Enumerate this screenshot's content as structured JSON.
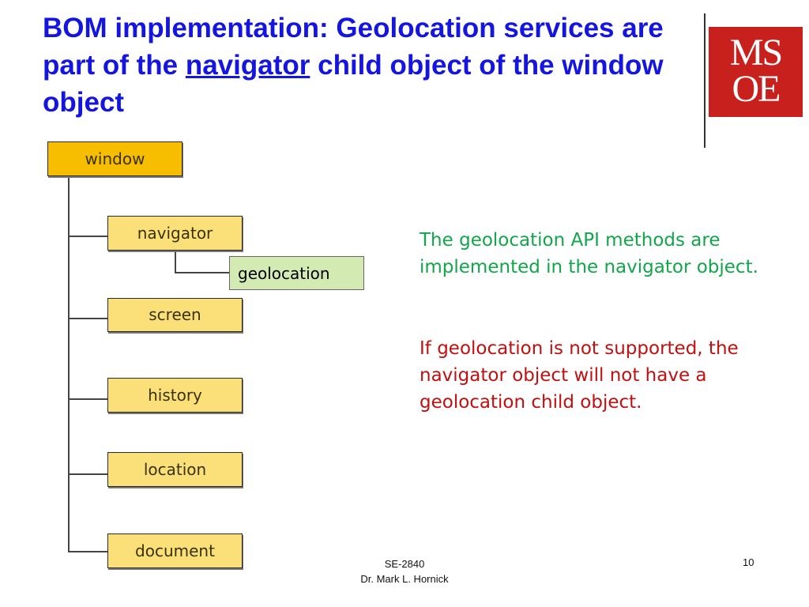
{
  "title": {
    "part1": "BOM implementation: Geolocation services are part of the ",
    "underlined": "navigator",
    "part2": " child object of the window object"
  },
  "logo": {
    "line1": "MS",
    "line2": "OE"
  },
  "diagram": {
    "root": "window",
    "children": [
      "navigator",
      "screen",
      "history",
      "location",
      "document"
    ],
    "subchild": "geolocation"
  },
  "notes": {
    "info": "The geolocation API methods are implemented in the navigator object.",
    "warning": "If geolocation is not supported, the navigator object will not have a geolocation child object."
  },
  "footer": {
    "course": "SE-2840",
    "author": "Dr. Mark L. Hornick",
    "page": "10"
  }
}
